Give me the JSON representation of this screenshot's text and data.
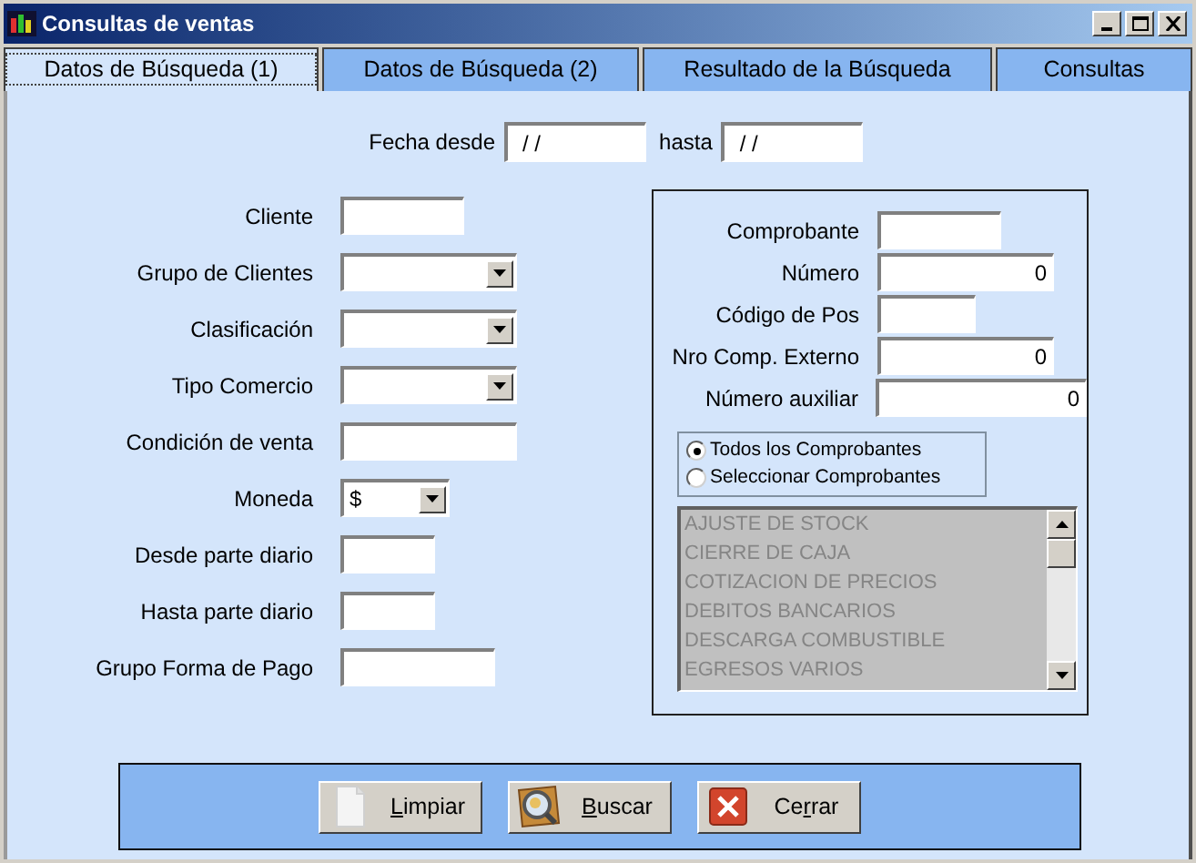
{
  "window": {
    "title": "Consultas de ventas"
  },
  "tabs": [
    {
      "label": "Datos de Búsqueda (1)",
      "selected": true
    },
    {
      "label": "Datos de Búsqueda (2)",
      "selected": false
    },
    {
      "label": "Resultado de la Búsqueda",
      "selected": false
    },
    {
      "label": "Consultas",
      "selected": false
    }
  ],
  "date_range": {
    "from_label": "Fecha desde",
    "from_value": "/ /",
    "to_label": "hasta",
    "to_value": "/ /"
  },
  "left_fields": [
    {
      "label": "Cliente",
      "kind": "text"
    },
    {
      "label": "Grupo de Clientes",
      "kind": "dropdown"
    },
    {
      "label": "Clasificación",
      "kind": "dropdown"
    },
    {
      "label": "Tipo Comercio",
      "kind": "dropdown"
    },
    {
      "label": "Condición de venta",
      "kind": "text"
    },
    {
      "label": "Moneda",
      "kind": "dropdown",
      "value": "$"
    },
    {
      "label": "Desde parte diario",
      "kind": "text"
    },
    {
      "label": "Hasta parte diario",
      "kind": "text"
    },
    {
      "label": "Grupo Forma de Pago",
      "kind": "text"
    }
  ],
  "right_fields": [
    {
      "label": "Comprobante"
    },
    {
      "label": "Número",
      "value": "0"
    },
    {
      "label": "Código de Pos"
    },
    {
      "label": "Nro Comp. Externo",
      "value": "0"
    },
    {
      "label": "Número auxiliar",
      "value": "0"
    }
  ],
  "radio_options": [
    {
      "label": "Todos los Comprobantes",
      "selected": true
    },
    {
      "label": "Seleccionar Comprobantes",
      "selected": false
    }
  ],
  "voucher_list": {
    "disabled": true,
    "items": [
      "AJUSTE DE STOCK",
      "CIERRE DE CAJA",
      "COTIZACION DE PRECIOS",
      "DEBITOS BANCARIOS",
      "DESCARGA COMBUSTIBLE",
      "EGRESOS VARIOS"
    ]
  },
  "buttons": [
    {
      "kind": "clear",
      "mnemonic": "L",
      "label_post": "impiar"
    },
    {
      "kind": "search",
      "mnemonic": "B",
      "label_post": "uscar"
    },
    {
      "kind": "close",
      "label_pre": "Ce",
      "mnemonic": "r",
      "label_post": "rar"
    }
  ]
}
